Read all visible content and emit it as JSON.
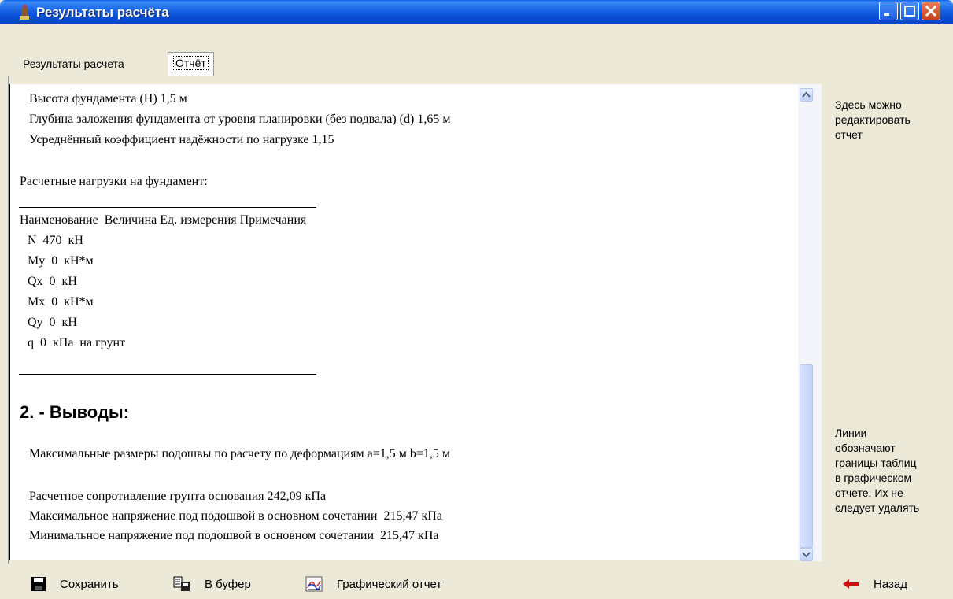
{
  "window": {
    "title": "Результаты расчёта"
  },
  "tabs": [
    {
      "label": "Результаты расчета"
    },
    {
      "label": "Отчёт"
    }
  ],
  "report": {
    "lines": [
      "Высота фундамента (H) 1,5 м",
      "Глубина заложения фундамента от уровня планировки (без подвала) (d) 1,65 м",
      "Усреднённый коэффициент надёжности по нагрузке 1,15",
      "Расчетные нагрузки на фундамент:"
    ],
    "table_header": "Наименование  Величина Ед. измерения Примечания",
    "table_rows": [
      "N  470  кН",
      "My  0  кН*м",
      "Qx  0  кН",
      "Mx  0  кН*м",
      "Qy  0  кН",
      "q  0  кПа  на грунт"
    ],
    "section_title": "2. - Выводы:",
    "conclusions": [
      "Максимальные размеры подошвы по расчету по деформациям a=1,5 м b=1,5 м",
      "Расчетное сопротивление грунта основания 242,09 кПа",
      "Максимальное напряжение под подошвой в основном сочетании  215,47 кПа",
      "Минимальное напряжение под подошвой в основном сочетании  215,47 кПа"
    ]
  },
  "hints": {
    "edit": [
      "Здесь можно",
      "редактировать",
      "отчет"
    ],
    "lines": [
      "Линии",
      "обозначают",
      "границы таблиц",
      "в графическом",
      "отчете. Их не",
      "следует удалять"
    ]
  },
  "toolbar": {
    "save_label": "Сохранить",
    "copy_label": "В буфер",
    "graph_label": "Графический отчет",
    "back_label": "Назад"
  },
  "icons": {
    "save": "floppy-disk-icon",
    "copy": "clipboard-icon",
    "graph": "chart-icon",
    "back": "arrow-left-icon",
    "app": "app-icon"
  },
  "colors": {
    "titlebar": "#0a4fd4",
    "window_bg": "#ece9d8",
    "close": "#c9411b"
  }
}
